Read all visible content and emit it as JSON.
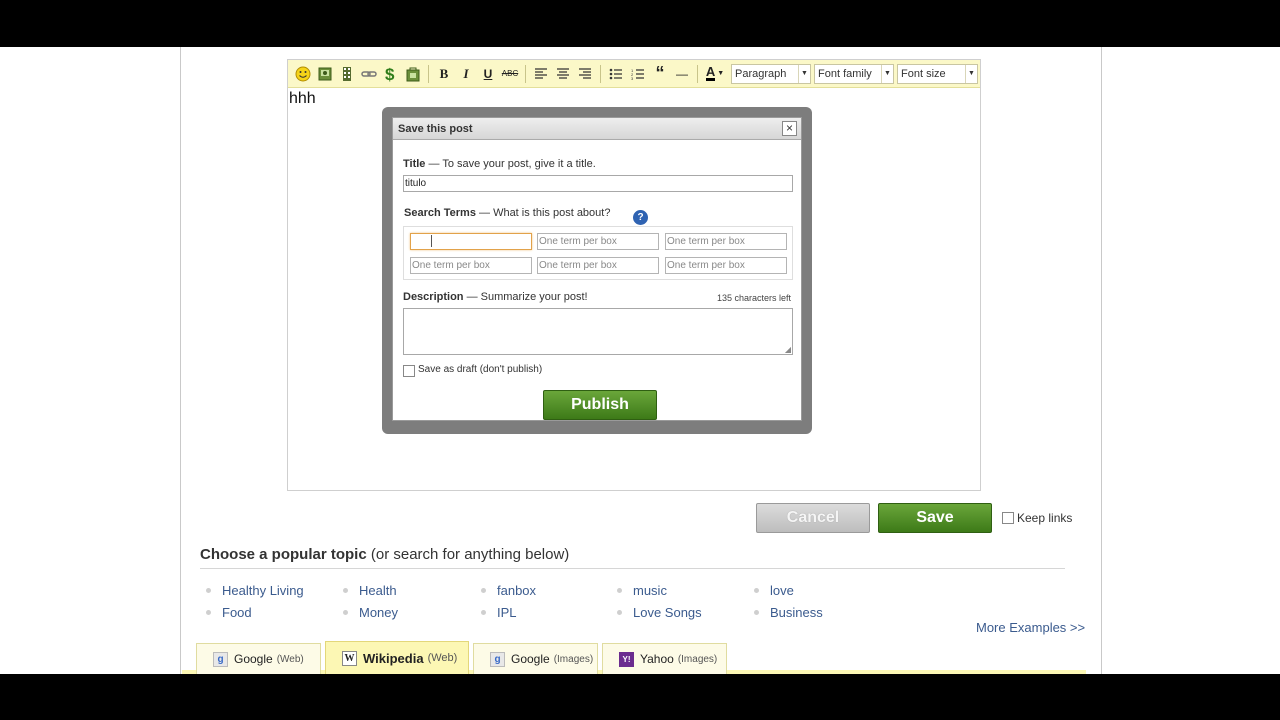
{
  "editor": {
    "text": "hhh",
    "toolbar": {
      "bold": "B",
      "italic": "I",
      "underline": "U",
      "strike": "ABC",
      "blockquote": "“",
      "hr": "—",
      "font_color": "A",
      "paragraph": "Paragraph",
      "font_family": "Font family",
      "font_size": "Font size"
    }
  },
  "dialog": {
    "title": "Save this post",
    "close": "×",
    "title_label": "Title",
    "title_hint": " — To save your post, give it a title.",
    "title_value": "titulo",
    "terms_label": "Search Terms",
    "terms_hint": " — What is this post about?",
    "help": "?",
    "term_placeholder": "One term per box",
    "desc_label": "Description",
    "desc_hint": " — Summarize your post!",
    "chars_left": "135 characters left",
    "draft_label": "Save as draft (don't publish)",
    "publish": "Publish"
  },
  "actions": {
    "cancel": "Cancel",
    "save": "Save",
    "keep_links": "Keep links"
  },
  "topics": {
    "title": "Choose a popular topic",
    "subtitle": " (or search for anything below)",
    "items": [
      "Healthy Living",
      "Food",
      "Health",
      "Money",
      "fanbox",
      "IPL",
      "music",
      "Love Songs",
      "love",
      "Business"
    ],
    "more": "More Examples >>"
  },
  "search_tabs": [
    {
      "name": "Google",
      "kind": "(Web)",
      "icon": "g"
    },
    {
      "name": "Wikipedia",
      "kind": "(Web)",
      "icon": "W"
    },
    {
      "name": "Google",
      "kind": "(Images)",
      "icon": "g"
    },
    {
      "name": "Yahoo",
      "kind": "(Images)",
      "icon": "Y!"
    }
  ],
  "colors": {
    "accent_green": "#4a8a22",
    "link_blue": "#3b5b8e",
    "toolbar_yellow": "#fbf8c8"
  }
}
